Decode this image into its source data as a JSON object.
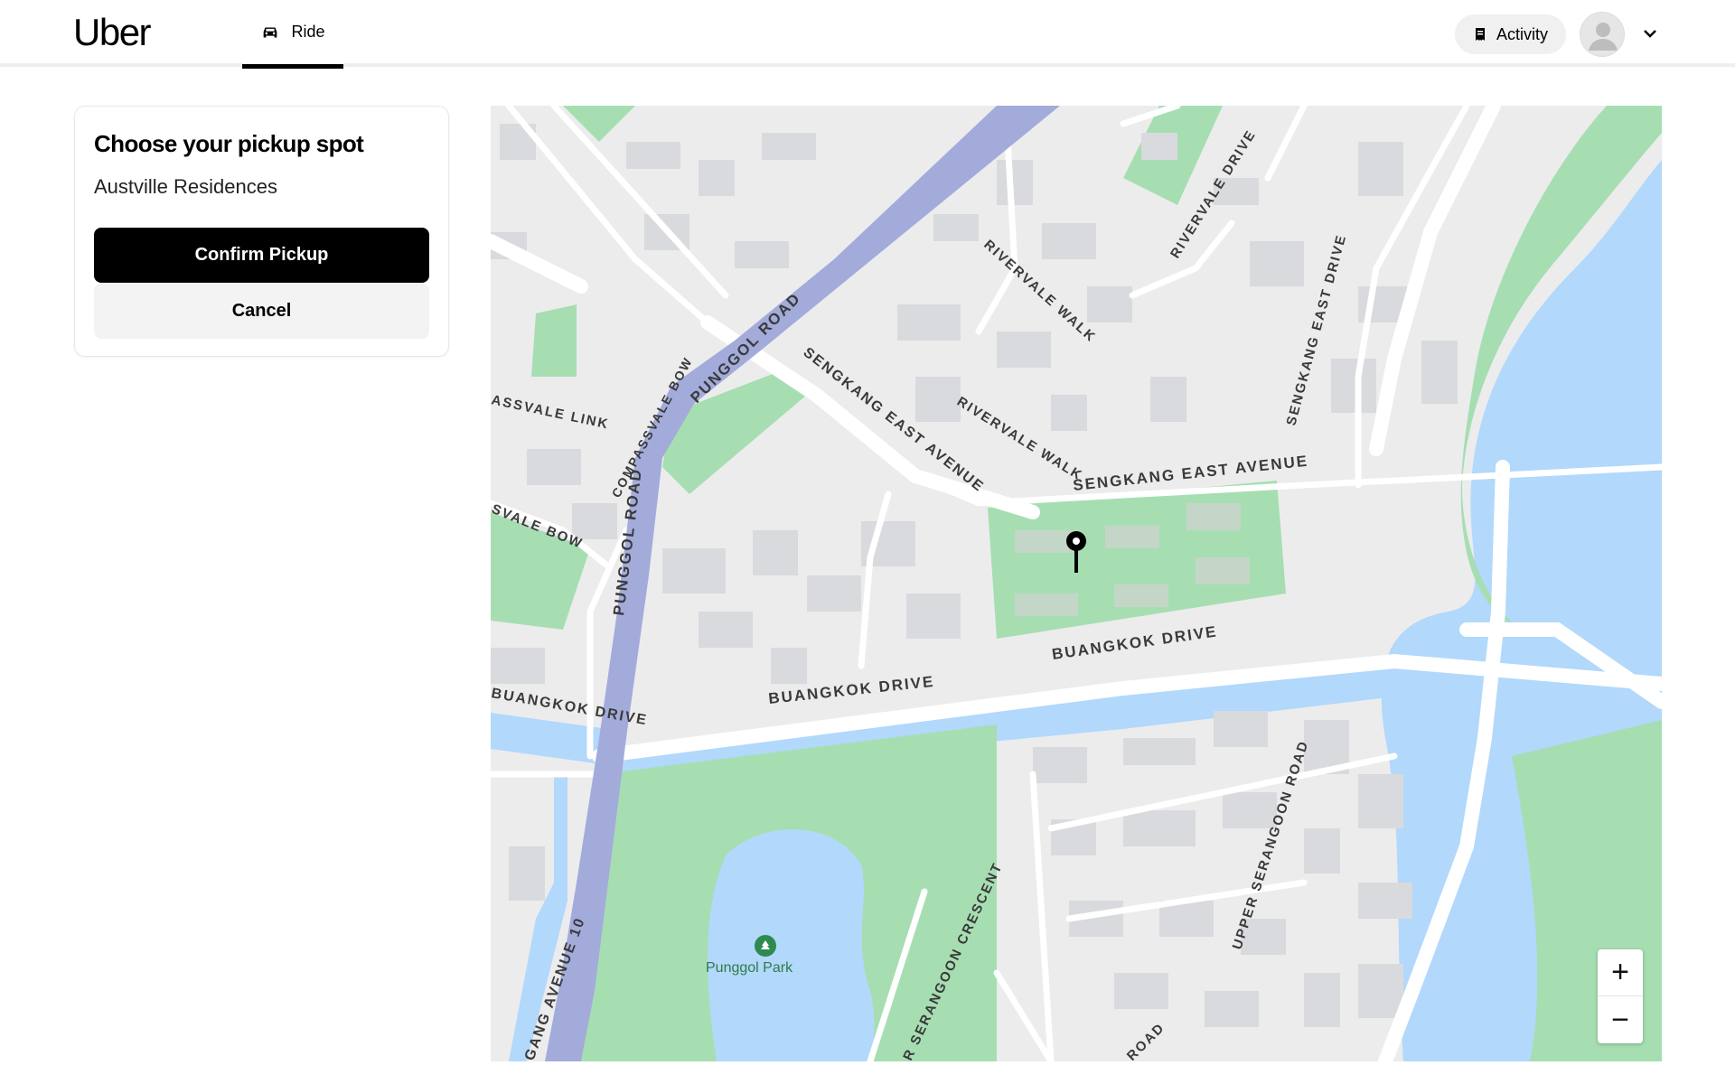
{
  "header": {
    "logo": "Uber",
    "ride_tab": "Ride",
    "activity_label": "Activity"
  },
  "pickup": {
    "title": "Choose your pickup spot",
    "location": "Austville Residences",
    "confirm_label": "Confirm Pickup",
    "cancel_label": "Cancel"
  },
  "map": {
    "labels": {
      "punggol_road_top": "PUNGGOL ROAD",
      "punggol_road_left": "PUNGGOL ROAD",
      "compassvale_bow": "COMPASSVALE BOW",
      "compassvale_link": "ASSVALE LINK",
      "compassvale_bow_left": "SVALE BOW",
      "sengkang_east_avenue_diag": "SENGKANG EAST AVENUE",
      "sengkang_east_avenue": "SENGKANG EAST AVENUE",
      "rivervale_walk_top": "RIVERVALE WALK",
      "rivervale_walk_mid": "RIVERVALE WALK",
      "rivervale_drive": "RIVERVALE DRIVE",
      "sengkang_east_drive": "SENGKANG EAST DRIVE",
      "buangkok_drive_right": "BUANGKOK DRIVE",
      "buangkok_drive_mid": "BUANGKOK DRIVE",
      "buangkok_drive_left": "BUANGKOK DRIVE",
      "upper_serangoon_road": "UPPER SERANGOON ROAD",
      "serangoon_crescent": "R SERANGOON CRESCENT",
      "sengkang_avenue_10": "GANG AVENUE 10",
      "road_bottom": "ROAD",
      "park_name": "Punggol Park"
    },
    "zoom_in": "+",
    "zoom_out": "−",
    "colors": {
      "land": "#ececed",
      "road": "#ffffff",
      "highway": "#a3abdb",
      "park": "#a6deb2",
      "water": "#b2d8fb",
      "building": "#d9dadd"
    }
  }
}
